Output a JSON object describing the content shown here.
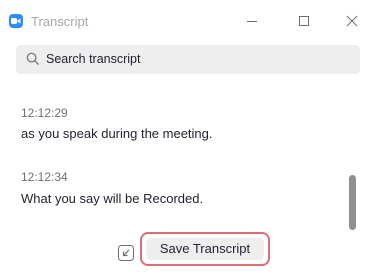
{
  "window": {
    "title": "Transcript",
    "brand_color": "#2D8CFF",
    "controls": [
      "minimize-icon",
      "maximize-icon",
      "close-icon"
    ]
  },
  "search": {
    "placeholder": "Search transcript",
    "icon": "search-icon"
  },
  "entries": [
    {
      "time": "12:12:29",
      "text": "as you speak during the meeting."
    },
    {
      "time": "12:12:34",
      "text": "What you say will be Recorded."
    }
  ],
  "footer": {
    "export_icon": "export-icon",
    "save_label": "Save Transcript",
    "highlight_color": "#e06c75"
  }
}
